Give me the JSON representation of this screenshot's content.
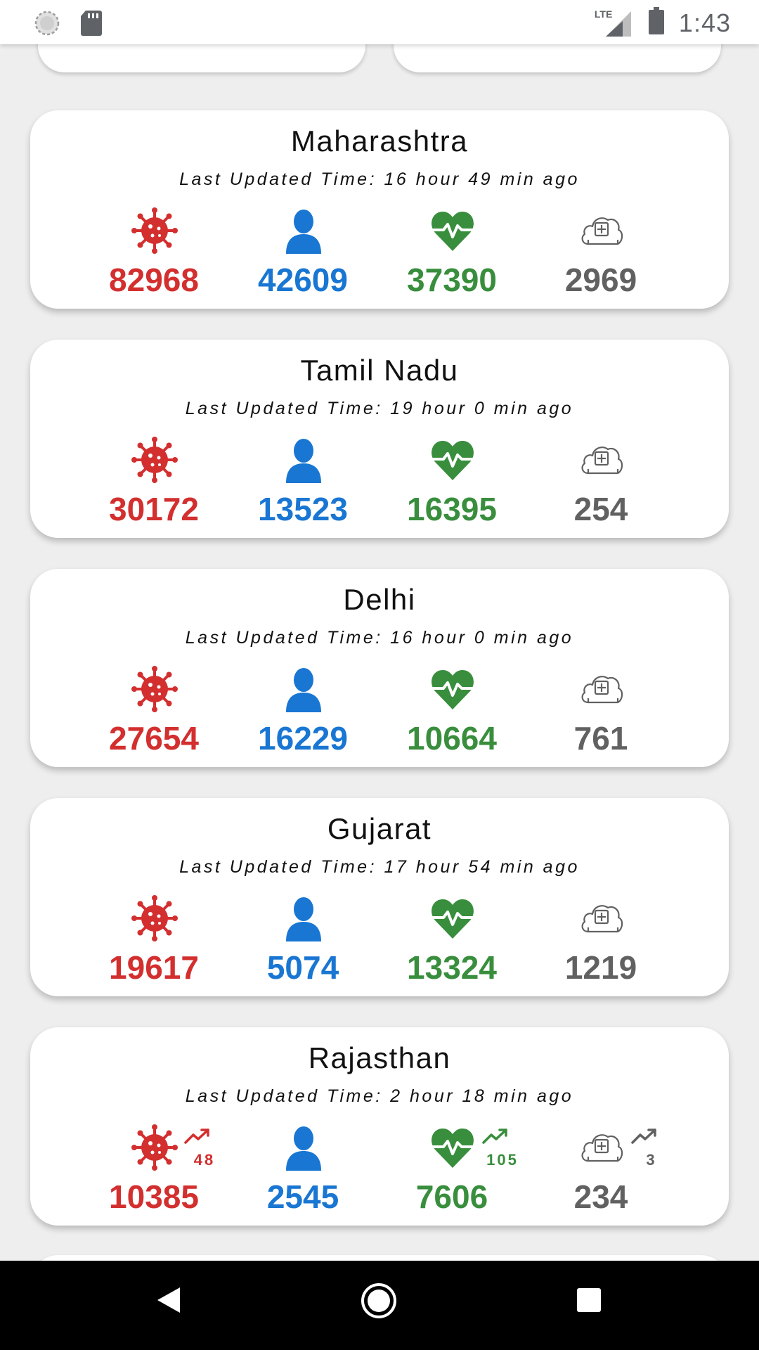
{
  "status_bar": {
    "time": "1:43",
    "network": "LTE"
  },
  "states": [
    {
      "name": "Maharashtra",
      "updated": "Last Updated Time: 16 hour 49 min ago",
      "confirmed": "82968",
      "active": "42609",
      "recovered": "37390",
      "deceased": "2969"
    },
    {
      "name": "Tamil Nadu",
      "updated": "Last Updated Time: 19 hour 0 min ago",
      "confirmed": "30172",
      "active": "13523",
      "recovered": "16395",
      "deceased": "254"
    },
    {
      "name": "Delhi",
      "updated": "Last Updated Time: 16 hour 0 min ago",
      "confirmed": "27654",
      "active": "16229",
      "recovered": "10664",
      "deceased": "761"
    },
    {
      "name": "Gujarat",
      "updated": "Last Updated Time: 17 hour 54 min ago",
      "confirmed": "19617",
      "active": "5074",
      "recovered": "13324",
      "deceased": "1219"
    },
    {
      "name": "Rajasthan",
      "updated": "Last Updated Time: 2 hour 18 min ago",
      "confirmed": "10385",
      "active": "2545",
      "recovered": "7606",
      "deceased": "234",
      "delta_confirmed": "48",
      "delta_recovered": "105",
      "delta_deceased": "3"
    }
  ],
  "icons": {
    "confirmed": "virus-icon",
    "active": "person-icon",
    "recovered": "heart-pulse-icon",
    "deceased": "cloud-cross-icon",
    "trend": "trending-up-icon"
  },
  "colors": {
    "confirmed": "#d32f2f",
    "active": "#1976d2",
    "recovered": "#388e3c",
    "deceased": "#616161"
  }
}
